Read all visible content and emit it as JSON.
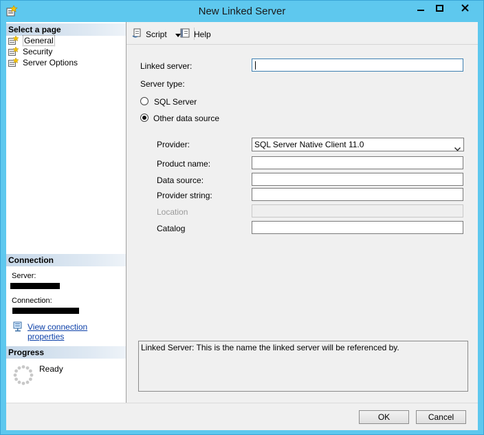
{
  "window": {
    "title": "New Linked Server"
  },
  "left_pane": {
    "select_page_header": "Select a page",
    "pages": [
      {
        "label": "General",
        "selected": true
      },
      {
        "label": "Security",
        "selected": false
      },
      {
        "label": "Server Options",
        "selected": false
      }
    ],
    "connection_header": "Connection",
    "server_label": "Server:",
    "connection_label": "Connection:",
    "view_connection_link": "View connection properties",
    "progress_header": "Progress",
    "progress_status": "Ready"
  },
  "toolbar": {
    "script_label": "Script",
    "help_label": "Help"
  },
  "form": {
    "linked_server_label": "Linked server:",
    "linked_server_value": "",
    "server_type_label": "Server type:",
    "sql_server_option": "SQL Server",
    "other_source_option": "Other data source",
    "selected_server_type": "Other data source",
    "provider_label": "Provider:",
    "provider_value": "SQL Server Native Client 11.0",
    "product_name_label": "Product name:",
    "product_name_value": "",
    "data_source_label": "Data source:",
    "data_source_value": "",
    "provider_string_label": "Provider string:",
    "provider_string_value": "",
    "location_label": "Location",
    "location_value": "",
    "catalog_label": "Catalog",
    "catalog_value": ""
  },
  "description": {
    "text": "Linked Server: This is the name the linked server will be referenced by."
  },
  "buttons": {
    "ok": "OK",
    "cancel": "Cancel"
  }
}
